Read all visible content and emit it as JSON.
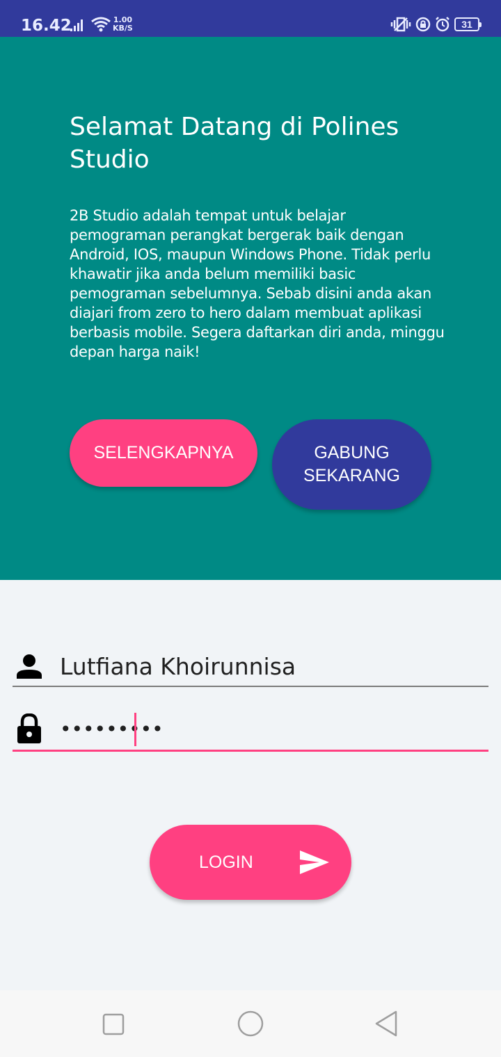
{
  "status_bar": {
    "time": "16.42",
    "net_speed_value": "1.00",
    "net_speed_unit": "KB/S",
    "battery": "31"
  },
  "hero": {
    "title": "Selamat Datang di Polines Studio",
    "description": "2B Studio adalah tempat untuk belajar pemograman perangkat bergerak baik dengan Android, IOS, maupun Windows Phone. Tidak perlu khawatir jika anda belum memiliki basic pemograman sebelumnya. Sebab disini anda akan diajari from zero to hero dalam membuat aplikasi berbasis mobile. Segera daftarkan diri anda, minggu depan harga naik!",
    "more_button": "SELENGKAPNYA",
    "join_button_line1": "GABUNG",
    "join_button_line2": "SEKARANG"
  },
  "form": {
    "username_value": "Lutfiana Khoirunnisa",
    "password_masked": "•••••••••",
    "login_button": "LOGIN"
  },
  "colors": {
    "primary_dark": "#313a9c",
    "teal": "#008a85",
    "accent": "#ff4081",
    "background": "#f1f4f7"
  }
}
